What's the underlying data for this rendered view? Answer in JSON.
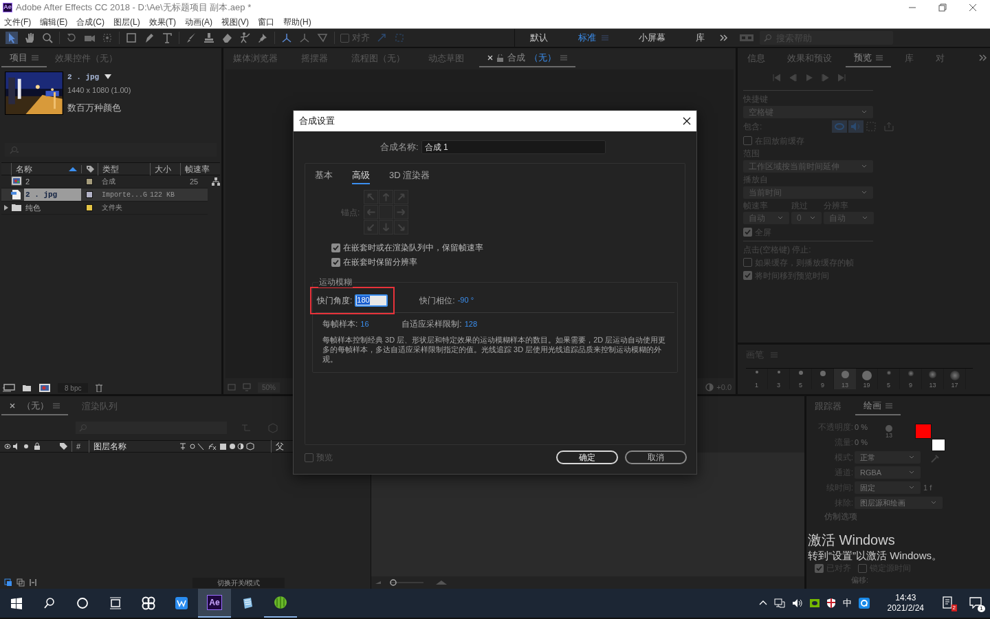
{
  "window": {
    "app_icon": "Ae",
    "title": "Adobe After Effects CC 2018 - D:\\Ae\\无标题项目 副本.aep *"
  },
  "menu": [
    "文件(F)",
    "编辑(E)",
    "合成(C)",
    "图层(L)",
    "效果(T)",
    "动画(A)",
    "视图(V)",
    "窗口",
    "帮助(H)"
  ],
  "toolbar": {
    "snap": {
      "label": "对齐",
      "checked": false
    }
  },
  "workspaces": [
    {
      "label": "默认",
      "selected": false
    },
    {
      "label": "标准",
      "selected": true
    },
    {
      "label": "小屏幕",
      "selected": false
    },
    {
      "label": "库",
      "selected": false
    }
  ],
  "help_search": {
    "placeholder": "搜索帮助"
  },
  "project_panel": {
    "tabs": [
      {
        "label": "项目",
        "selected": true
      },
      {
        "label": "效果控件（无）",
        "selected": false
      }
    ],
    "preview": {
      "name": "2 . jpg",
      "dimensions": "1440 x 1080 (1.00)",
      "colors": "数百万种颜色"
    },
    "columns": [
      "名称",
      "类型",
      "大小",
      "帧速率"
    ],
    "rows": [
      {
        "kind": "comp",
        "name": "2",
        "type": "合成",
        "fps": "25",
        "color": "#a59c7c",
        "selected": false
      },
      {
        "kind": "footage",
        "name": "2 . jpg",
        "type": "Importe...G",
        "size": "122 KB",
        "color": "#b4b4c8",
        "selected": true
      },
      {
        "kind": "folder",
        "name": "纯色",
        "type": "文件夹",
        "color": "#e5c546",
        "selected": false
      }
    ],
    "bit_depth": "8 bpc"
  },
  "viewer": {
    "tabs": [
      {
        "label": "媒体浏览器",
        "selected": false
      },
      {
        "label": "摇摆器",
        "selected": false
      },
      {
        "label": "流程图（无）",
        "selected": false
      },
      {
        "label": "动态草图",
        "selected": false
      },
      {
        "label": "合成",
        "detail": "（无）",
        "selected": true
      }
    ],
    "zoom": "50%",
    "exposure": "+0.0"
  },
  "right_panel": {
    "tabs": [
      {
        "label": "信息",
        "selected": false
      },
      {
        "label": "效果和预设",
        "selected": false
      },
      {
        "label": "预览",
        "selected": true
      },
      {
        "label": "库",
        "selected": false
      },
      {
        "label": "对",
        "selected": false
      }
    ],
    "items": [
      {
        "kind": "heading",
        "text": "快捷键",
        "divider_above": true
      },
      {
        "kind": "dropdown",
        "value": "空格键"
      },
      {
        "kind": "include",
        "text": "包含:"
      },
      {
        "kind": "checkbox",
        "text": "在回放前缓存",
        "checked": false
      },
      {
        "kind": "heading",
        "text": "范围",
        "divider_above": false
      },
      {
        "kind": "dropdown",
        "value": "工作区域按当前时间延伸"
      },
      {
        "kind": "heading",
        "text": "播放自",
        "divider_above": false
      },
      {
        "kind": "dropdown",
        "value": "当前时间"
      },
      {
        "kind": "triple",
        "labels": [
          "帧速率",
          "跳过",
          "分辨率"
        ],
        "values": [
          "自动",
          "0",
          "自动"
        ]
      },
      {
        "kind": "checkbox",
        "text": "全屏",
        "checked": true
      },
      {
        "kind": "heading",
        "text": "点击(空格键) 停止:",
        "divider_above": true
      },
      {
        "kind": "checkbox",
        "text": "如果缓存，则播放缓存的帧",
        "checked": false
      },
      {
        "kind": "checkbox",
        "text": "将时间移到预览时间",
        "checked": true
      }
    ]
  },
  "brush_panel": {
    "title": "画笔",
    "brushes": [
      {
        "size": "1",
        "soft": false,
        "selected": false
      },
      {
        "size": "3",
        "soft": false,
        "selected": false
      },
      {
        "size": "5",
        "soft": false,
        "selected": false
      },
      {
        "size": "9",
        "soft": false,
        "selected": false
      },
      {
        "size": "13",
        "soft": false,
        "selected": true
      },
      {
        "size": "19",
        "soft": false,
        "selected": false
      },
      {
        "size": "5",
        "soft": true,
        "selected": false
      },
      {
        "size": "9",
        "soft": true,
        "selected": false
      },
      {
        "size": "13",
        "soft": true,
        "selected": false
      },
      {
        "size": "17",
        "soft": true,
        "selected": false
      }
    ]
  },
  "timeline": {
    "tabs": [
      {
        "label": "（无）",
        "selected": true
      },
      {
        "label": "渲染队列",
        "selected": false
      }
    ],
    "columns": [
      "#",
      "图层名称",
      "父"
    ],
    "footer": "切换开关/模式"
  },
  "paint_panel": {
    "tabs": [
      {
        "label": "跟踪器",
        "selected": false
      },
      {
        "label": "绘画",
        "selected": true
      }
    ],
    "fields": [
      {
        "kind": "value",
        "label": "不透明度:",
        "value": "0 %"
      },
      {
        "kind": "value",
        "label": "流量:",
        "value": "0 %"
      },
      {
        "kind": "dropdown",
        "label": "模式:",
        "value": "正常"
      },
      {
        "kind": "dropdown",
        "label": "通道:",
        "value": "RGBA"
      },
      {
        "kind": "dropdown",
        "label": "续时间:",
        "value": "固定",
        "suffix": "1 f"
      },
      {
        "kind": "dropdown",
        "label": "抹除:",
        "value": "图层源和绘画"
      }
    ],
    "brush_size": "13",
    "colors": [
      {
        "kind": "foreground",
        "color": "#ff0000"
      },
      {
        "kind": "background",
        "color": "#ffffff"
      }
    ],
    "clone_title": "仿制选项",
    "clone_checks": [
      {
        "label": "已对齐",
        "checked": true
      },
      {
        "label": "锁定源时间",
        "checked": false
      }
    ],
    "offset_label": "偏移:"
  },
  "activation": {
    "title": "激活 Windows",
    "message": "转到“设置”以激活 Windows。"
  },
  "dialog": {
    "title": "合成设置",
    "name_label": "合成名称:",
    "name_value": "合成 1",
    "tabs": [
      {
        "label": "基本",
        "selected": false
      },
      {
        "label": "高级",
        "selected": true
      },
      {
        "label": "3D 渲染器",
        "selected": false
      }
    ],
    "anchor_label": "锚点:",
    "options": [
      {
        "label": "在嵌套时或在渲染队列中，保留帧速率",
        "checked": true
      },
      {
        "label": "在嵌套时保留分辨率",
        "checked": true
      }
    ],
    "motion_blur": {
      "title": "运动模糊",
      "shutter_angle_label": "快门角度:",
      "shutter_angle": "180",
      "highlighted": true,
      "shutter_phase_label": "快门相位:",
      "shutter_phase": "-90 °",
      "samples_label": "每帧样本:",
      "samples": "16",
      "adaptive_label": "自适应采样限制:",
      "adaptive": "128",
      "description": "每帧样本控制经典 3D 层、形状层和特定效果的运动模糊样本的数目。如果需要，2D 层运动自动使用更多的每帧样本，多达自适应采样限制指定的值。光线追踪 3D 层使用光线追踪品质来控制运动模糊的外观。"
    },
    "preview": {
      "label": "预览",
      "checked": false
    },
    "buttons": [
      {
        "label": "确定",
        "kind": "primary"
      },
      {
        "label": "取消",
        "kind": "secondary"
      }
    ]
  },
  "taskbar": {
    "apps": [
      {
        "kind": "start"
      },
      {
        "kind": "search"
      },
      {
        "kind": "cortana"
      },
      {
        "kind": "taskview"
      },
      {
        "kind": "pinwheel"
      },
      {
        "kind": "wps"
      },
      {
        "kind": "ae",
        "text": "Ae",
        "active": true
      },
      {
        "kind": "notepad"
      },
      {
        "kind": "melon"
      }
    ],
    "ime": "中",
    "time": "14:43",
    "date": "2021/2/24",
    "notification_count": "2",
    "action_count": "1"
  }
}
